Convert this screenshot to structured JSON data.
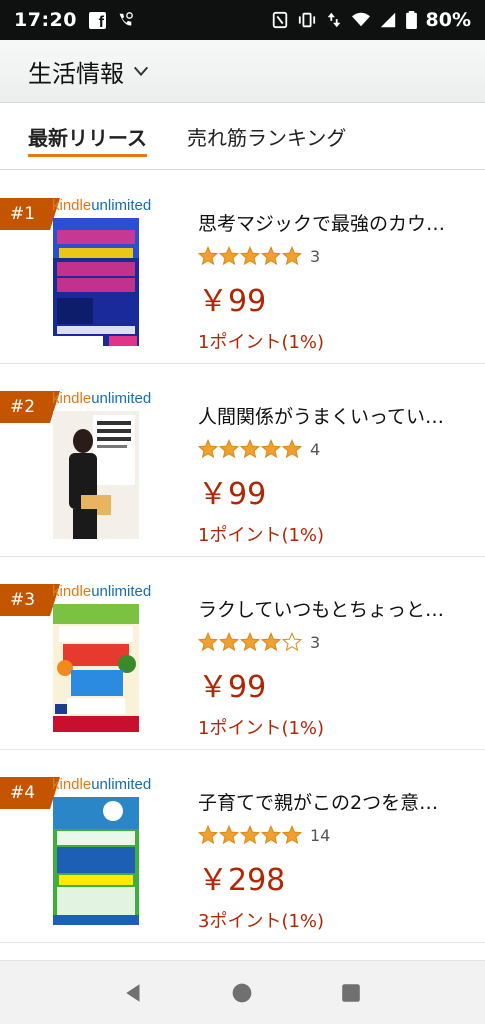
{
  "status_bar": {
    "time": "17:20",
    "battery": "80%",
    "icons": [
      "facebook-icon",
      "wifi-calling-icon",
      "nfc-icon",
      "vibrate-icon",
      "data-arrows-icon",
      "wifi-icon",
      "signal-icon",
      "battery-icon"
    ]
  },
  "header": {
    "title": "生活情報",
    "icon": "chevron-down-icon"
  },
  "tabs": [
    {
      "label": "最新リリース",
      "active": true
    },
    {
      "label": "売れ筋ランキング",
      "active": false
    }
  ],
  "kindle_unlimited": {
    "part1": "kindle",
    "part2": "unlimited"
  },
  "items": [
    {
      "rank": "#1",
      "title": "思考マジックで最強のカウ…",
      "rating": 5,
      "rating_count": "3",
      "price": "￥99",
      "points": "1ポイント(1%)"
    },
    {
      "rank": "#2",
      "title": "人間関係がうまくいってい…",
      "rating": 5,
      "rating_count": "4",
      "price": "￥99",
      "points": "1ポイント(1%)"
    },
    {
      "rank": "#3",
      "title": "ラクしていつもとちょっと…",
      "rating": 4,
      "rating_count": "3",
      "price": "￥99",
      "points": "1ポイント(1%)"
    },
    {
      "rank": "#4",
      "title": "子育てで親がこの2つを意…",
      "rating": 5,
      "rating_count": "14",
      "price": "￥298",
      "points": "3ポイント(1%)"
    }
  ],
  "colors": {
    "accent": "#e47911",
    "rank_badge": "#c45500",
    "price": "#b12704",
    "star": "#f0a030"
  },
  "nav_bar": {
    "icons": [
      "back-icon",
      "home-icon",
      "recents-icon"
    ]
  }
}
